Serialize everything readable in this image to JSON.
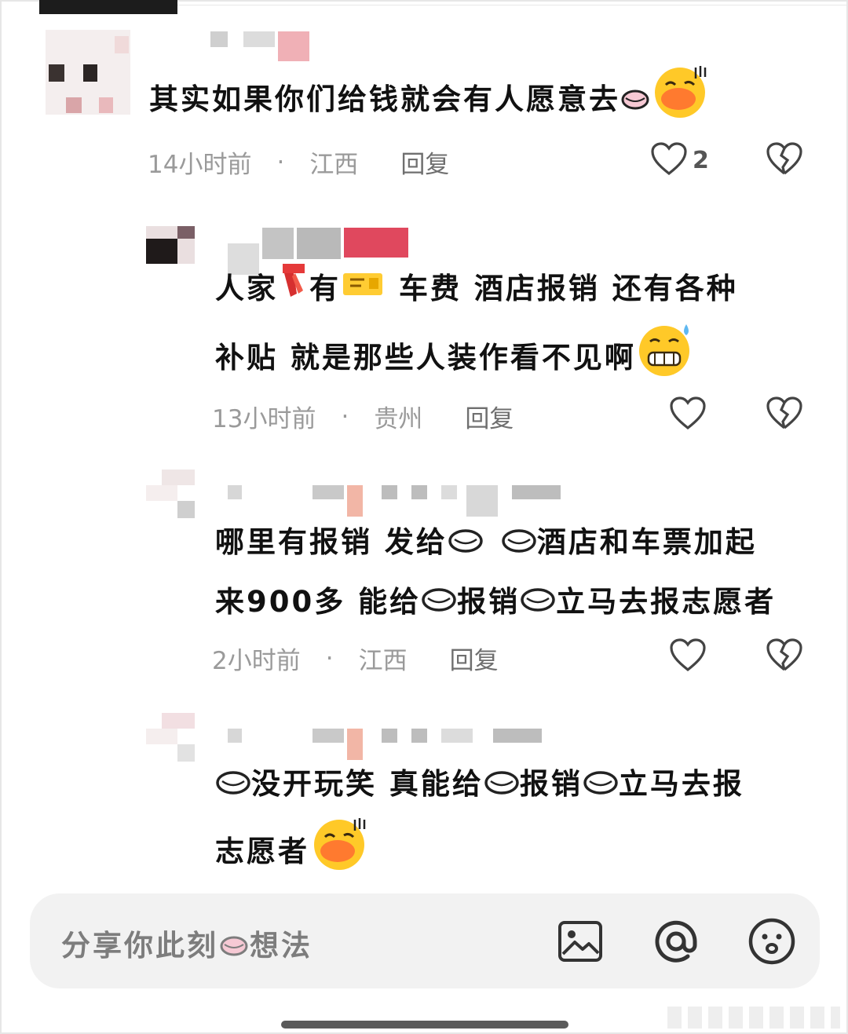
{
  "comments": [
    {
      "text": "其实如果你们给钱就会有人愿意去",
      "time": "14小时前",
      "location": "江西",
      "reply_label": "回复",
      "likes": "2"
    },
    {
      "text_line1_a": "人家",
      "text_line1_b": "有",
      "text_line1_c": "车费 酒店报销 还有各种",
      "text_line2": "补贴 就是那些人装作看不见啊",
      "time": "13小时前",
      "location": "贵州",
      "reply_label": "回复"
    },
    {
      "l1_a": "哪里有报销 发给",
      "l1_b": "酒店和车票加起",
      "l2_a": "来900多 能给",
      "l2_b": "报销",
      "l2_c": "立马去报志愿者",
      "time": "2小时前",
      "location": "江西",
      "reply_label": "回复"
    },
    {
      "l1_a": "没开玩笑 真能给",
      "l1_b": "报销",
      "l1_c": "立马去报",
      "l2": "志愿者"
    }
  ],
  "input": {
    "placeholder_a": "分享你此刻",
    "placeholder_b": "想法"
  },
  "icons": {
    "image": "image-icon",
    "at": "at-icon",
    "emoji": "emoji-icon",
    "like": "heart-icon",
    "dislike": "broken-heart-icon"
  }
}
